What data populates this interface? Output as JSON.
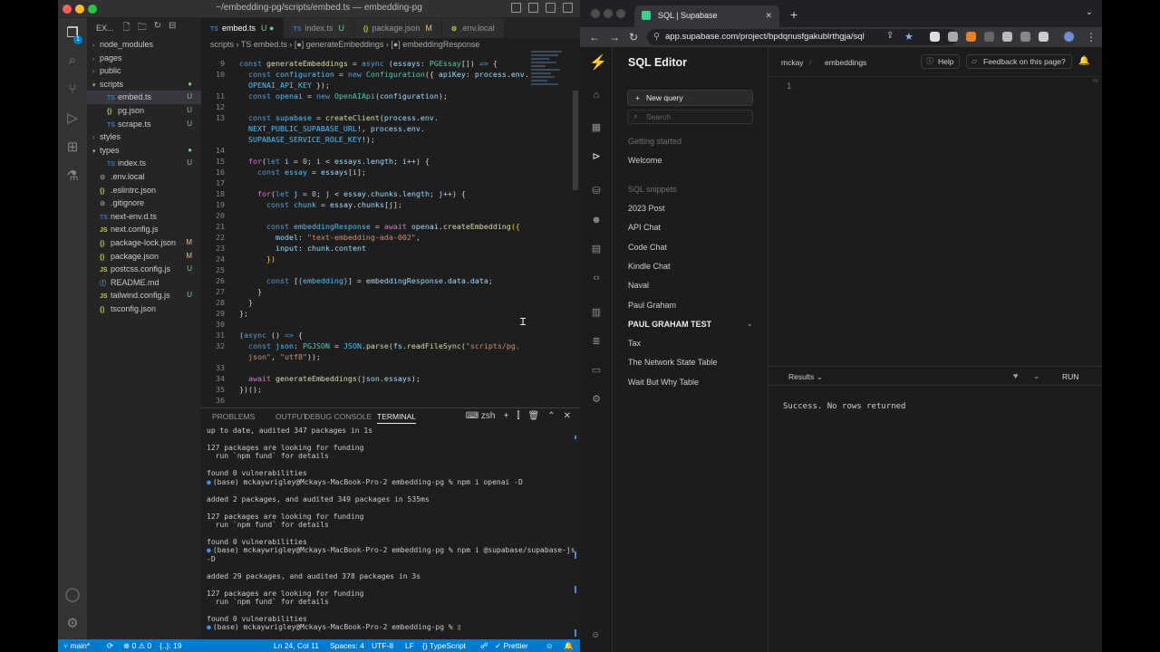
{
  "vscode": {
    "window_title": "~/embedding-pg/scripts/embed.ts — embedding-pg",
    "activity_badge": "1",
    "explorer_label": "EX...",
    "tree": [
      {
        "label": "node_modules",
        "kind": "folder",
        "open": false,
        "indent": 0,
        "status": ""
      },
      {
        "label": "pages",
        "kind": "folder",
        "open": false,
        "indent": 0,
        "status": ""
      },
      {
        "label": "public",
        "kind": "folder",
        "open": false,
        "indent": 0,
        "status": ""
      },
      {
        "label": "scripts",
        "kind": "folder",
        "open": true,
        "indent": 0,
        "status": "●"
      },
      {
        "label": "embed.ts",
        "kind": "ts",
        "indent": 1,
        "status": "U",
        "selected": true
      },
      {
        "label": "pg.json",
        "kind": "json",
        "indent": 1,
        "status": "U"
      },
      {
        "label": "scrape.ts",
        "kind": "ts",
        "indent": 1,
        "status": "U"
      },
      {
        "label": "styles",
        "kind": "folder",
        "open": false,
        "indent": 0,
        "status": ""
      },
      {
        "label": "types",
        "kind": "folder",
        "open": true,
        "indent": 0,
        "status": "●"
      },
      {
        "label": "index.ts",
        "kind": "ts",
        "indent": 1,
        "status": "U"
      },
      {
        "label": ".env.local",
        "kind": "dot",
        "indent": 0,
        "status": ""
      },
      {
        "label": ".eslintrc.json",
        "kind": "json",
        "indent": 0,
        "status": ""
      },
      {
        "label": ".gitignore",
        "kind": "dot",
        "indent": 0,
        "status": ""
      },
      {
        "label": "next-env.d.ts",
        "kind": "ts",
        "indent": 0,
        "status": ""
      },
      {
        "label": "next.config.js",
        "kind": "js",
        "indent": 0,
        "status": ""
      },
      {
        "label": "package-lock.json",
        "kind": "json",
        "indent": 0,
        "status": "M"
      },
      {
        "label": "package.json",
        "kind": "json",
        "indent": 0,
        "status": "M"
      },
      {
        "label": "postcss.config.js",
        "kind": "js",
        "indent": 0,
        "status": "U"
      },
      {
        "label": "README.md",
        "kind": "md",
        "indent": 0,
        "status": ""
      },
      {
        "label": "tailwind.config.js",
        "kind": "js",
        "indent": 0,
        "status": "U"
      },
      {
        "label": "tsconfig.json",
        "kind": "json",
        "indent": 0,
        "status": ""
      }
    ],
    "tabs": [
      {
        "label": "embed.ts",
        "icon": "TS",
        "marker": "U ●",
        "active": true
      },
      {
        "label": "index.ts",
        "icon": "TS",
        "marker": "U",
        "active": false
      },
      {
        "label": "package.json",
        "icon": "{}",
        "marker": "M",
        "active": false
      },
      {
        "label": ".env.local",
        "icon": "⚙",
        "marker": "",
        "active": false
      }
    ],
    "breadcrumb": "scripts  ›  TS embed.ts  ›  [●] generateEmbeddings  ›  [●] embeddingResponse",
    "code_lines": [
      {
        "n": "9",
        "html": "<span class=\"k\">const</span> <span class=\"f\">generateEmbeddings</span> = <span class=\"k\">async</span> (<span class=\"v\">essays</span>: <span class=\"c\">PGEssay</span>[]) <span class=\"k\">=&gt;</span> {",
        "indent": 0
      },
      {
        "n": "10",
        "html": "<span class=\"k\">const</span> <span class=\"cv\">configuration</span> = <span class=\"k\">new</span> <span class=\"c\">Configuration</span>({ <span class=\"v\">apiKey</span>: <span class=\"v\">process</span>.<span class=\"v\">env</span>.",
        "indent": 1
      },
      {
        "n": "",
        "html": "<span class=\"cv\">OPENAI_API_KEY</span> });",
        "indent": 1
      },
      {
        "n": "11",
        "html": "<span class=\"k\">const</span> <span class=\"cv\">openai</span> = <span class=\"k\">new</span> <span class=\"c\">OpenAIApi</span>(<span class=\"v\">configuration</span>);",
        "indent": 1
      },
      {
        "n": "12",
        "html": "",
        "indent": 0
      },
      {
        "n": "13",
        "html": "<span class=\"k\">const</span> <span class=\"cv\">supabase</span> = <span class=\"f\">createClient</span>(<span class=\"v\">process</span>.<span class=\"v\">env</span>.",
        "indent": 1
      },
      {
        "n": "",
        "html": "<span class=\"cv\">NEXT_PUBLIC_SUPABASE_URL</span>!, <span class=\"v\">process</span>.<span class=\"v\">env</span>.",
        "indent": 1
      },
      {
        "n": "",
        "html": "<span class=\"cv\">SUPABASE_SERVICE_ROLE_KEY</span>!);",
        "indent": 1
      },
      {
        "n": "14",
        "html": "",
        "indent": 0
      },
      {
        "n": "15",
        "html": "<span class=\"pp\">for</span>(<span class=\"k\">let</span> <span class=\"v\">i</span> = <span class=\"n\">0</span>; <span class=\"v\">i</span> &lt; <span class=\"v\">essays</span>.<span class=\"v\">length</span>; <span class=\"v\">i</span>++) {",
        "indent": 1
      },
      {
        "n": "16",
        "html": "<span class=\"k\">const</span> <span class=\"cv\">essay</span> = <span class=\"v\">essays</span>[<span class=\"v\">i</span>];",
        "indent": 2
      },
      {
        "n": "17",
        "html": "",
        "indent": 0
      },
      {
        "n": "18",
        "html": "<span class=\"pp\">for</span>(<span class=\"k\">let</span> <span class=\"v\">j</span> = <span class=\"n\">0</span>; <span class=\"v\">j</span> &lt; <span class=\"v\">essay</span>.<span class=\"v\">chunks</span>.<span class=\"v\">length</span>; <span class=\"v\">j</span>++) {",
        "indent": 2
      },
      {
        "n": "19",
        "html": "<span class=\"k\">const</span> <span class=\"cv\">chunk</span> = <span class=\"v\">essay</span>.<span class=\"v\">chunks</span>[<span class=\"v\">j</span>];",
        "indent": 3
      },
      {
        "n": "20",
        "html": "",
        "indent": 0
      },
      {
        "n": "21",
        "html": "<span class=\"k\">const</span> <span class=\"cv\">embeddingResponse</span> = <span class=\"pp\">await</span> <span class=\"v\">openai</span>.<span class=\"f\">createEmbedding</span><span class=\"p\">({</span>",
        "indent": 3
      },
      {
        "n": "22",
        "html": "<span class=\"v\">model</span>: <span class=\"s\">\"text-embedding-ada-002\"</span>,",
        "indent": 4
      },
      {
        "n": "23",
        "html": "<span class=\"v\">input</span>: <span class=\"v\">chunk</span>.<span class=\"v\">content</span>",
        "indent": 4
      },
      {
        "n": "24",
        "html": "<span class=\"p\">})</span>",
        "indent": 3
      },
      {
        "n": "25",
        "html": "",
        "indent": 0
      },
      {
        "n": "26",
        "html": "<span class=\"k\">const</span> [<span class=\"cv\">{embedding}</span>] = <span class=\"v\">embeddingResponse</span>.<span class=\"v\">data</span>.<span class=\"v\">data</span>;",
        "indent": 3
      },
      {
        "n": "27",
        "html": "}",
        "indent": 2
      },
      {
        "n": "28",
        "html": "}",
        "indent": 1
      },
      {
        "n": "29",
        "html": "};",
        "indent": 0
      },
      {
        "n": "30",
        "html": "",
        "indent": 0
      },
      {
        "n": "31",
        "html": "(<span class=\"k\">async</span> () <span class=\"k\">=&gt;</span> {",
        "indent": 0
      },
      {
        "n": "32",
        "html": "<span class=\"k\">const</span> <span class=\"cv\">json</span>: <span class=\"c\">PGJSON</span> = <span class=\"cv\">JSON</span>.<span class=\"f\">parse</span>(<span class=\"v\">fs</span>.<span class=\"f\">readFileSync</span>(<span class=\"s\">\"scripts/pg.</span>",
        "indent": 1
      },
      {
        "n": "",
        "html": "<span class=\"s\">json\"</span>, <span class=\"s\">\"utf8\"</span>));",
        "indent": 1
      },
      {
        "n": "33",
        "html": "",
        "indent": 0
      },
      {
        "n": "34",
        "html": "<span class=\"pp\">await</span> <span class=\"f\">generateEmbeddings</span>(<span class=\"v\">json</span>.<span class=\"v\">essays</span>);",
        "indent": 1
      },
      {
        "n": "35",
        "html": "})();",
        "indent": 0
      },
      {
        "n": "36",
        "html": "",
        "indent": 0
      }
    ],
    "panel_tabs": [
      "PROBLEMS",
      "OUTPUT",
      "DEBUG CONSOLE",
      "TERMINAL"
    ],
    "terminal_shell": "zsh",
    "terminal_lines": [
      {
        "text": "up to date, audited 347 packages in 1s",
        "prompt": false
      },
      {
        "text": "",
        "prompt": false
      },
      {
        "text": "127 packages are looking for funding",
        "prompt": false
      },
      {
        "text": "  run `npm fund` for details",
        "prompt": false
      },
      {
        "text": "",
        "prompt": false
      },
      {
        "text": "found 0 vulnerabilities",
        "prompt": false
      },
      {
        "text": "(base) mckaywrigley@Mckays-MacBook-Pro-2 embedding-pg % npm i openai -D",
        "prompt": true
      },
      {
        "text": "",
        "prompt": false
      },
      {
        "text": "added 2 packages, and audited 349 packages in 535ms",
        "prompt": false
      },
      {
        "text": "",
        "prompt": false
      },
      {
        "text": "127 packages are looking for funding",
        "prompt": false
      },
      {
        "text": "  run `npm fund` for details",
        "prompt": false
      },
      {
        "text": "",
        "prompt": false
      },
      {
        "text": "found 0 vulnerabilities",
        "prompt": false
      },
      {
        "text": "(base) mckaywrigley@Mckays-MacBook-Pro-2 embedding-pg % npm i @supabase/supabase-js",
        "prompt": true
      },
      {
        "text": "-D",
        "prompt": false
      },
      {
        "text": "",
        "prompt": false
      },
      {
        "text": "added 29 packages, and audited 378 packages in 3s",
        "prompt": false
      },
      {
        "text": "",
        "prompt": false
      },
      {
        "text": "127 packages are looking for funding",
        "prompt": false
      },
      {
        "text": "  run `npm fund` for details",
        "prompt": false
      },
      {
        "text": "",
        "prompt": false
      },
      {
        "text": "found 0 vulnerabilities",
        "prompt": false
      },
      {
        "text": "(base) mckaywrigley@Mckays-MacBook-Pro-2 embedding-pg % ▯",
        "prompt": true
      }
    ],
    "status": {
      "branch": "main*",
      "problems": "⊗ 0 ⚠ 0",
      "lang_summary": "{..}: 19",
      "position": "Ln 24, Col 11",
      "spaces": "Spaces: 4",
      "encoding": "UTF-8",
      "eol": "LF",
      "language": "{} TypeScript",
      "formatter": "✓ Prettier"
    }
  },
  "browser": {
    "tab_title": "SQL | Supabase",
    "url": "app.supabase.com/project/bpdqnusfgakublrthgja/sql",
    "page": {
      "title": "SQL Editor",
      "new_query": "New query",
      "search_placeholder": "Search",
      "getting_started_label": "Getting started",
      "welcome": "Welcome",
      "snippets_label": "SQL snippets",
      "snippets": [
        "2023 Post",
        "API Chat",
        "Code Chat",
        "Kindle Chat",
        "Naval",
        "Paul Graham",
        "PAUL GRAHAM TEST",
        "Tax",
        "The Network State Table",
        "Wait But Why Table"
      ],
      "crumb_project": "mckay",
      "crumb_page": "embeddings",
      "help": "Help",
      "feedback": "Feedback on this page?",
      "line_number": "1",
      "results_label": "Results",
      "run_label": "RUN",
      "result_text": "Success. No rows returned"
    }
  }
}
